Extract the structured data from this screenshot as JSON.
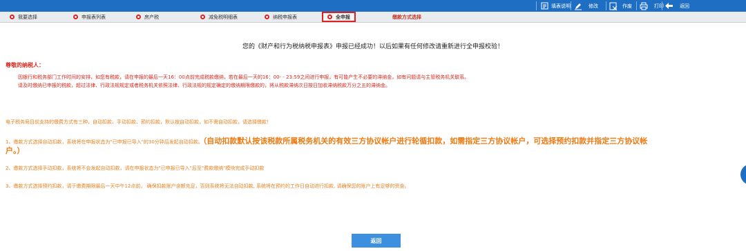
{
  "toolbar": {
    "items": [
      {
        "label": "填表说明",
        "icon": "document-icon"
      },
      {
        "label": "修改",
        "icon": "pencil-icon"
      },
      {
        "label": "作废",
        "icon": "void-icon"
      },
      {
        "label": "打印",
        "icon": "printer-icon"
      },
      {
        "label": "返回",
        "icon": "back-arrow-icon"
      }
    ]
  },
  "steps": [
    {
      "label": "我要选择"
    },
    {
      "label": "申报表列表"
    },
    {
      "label": "房产税"
    },
    {
      "label": "减免税明细表"
    },
    {
      "label": "纳税申报表"
    },
    {
      "label": "全申报"
    },
    {
      "label": "缴款方式选择"
    }
  ],
  "main": {
    "success_message": "您的《财产和行为税纳税申报表》申报已经成功！以后如果有任何修改请重新进行全申报校验！",
    "dear_label": "尊敬的纳税人：",
    "notice_lines": [
      "因银行和税务部门工作时间的安排，如您有税款，请在申报的最后一天16：00点前完成税款缴纳，若在最后一天的16：00- - 23:59之间进行申报，有可能产生不必要的滞纳金，如有问题请与主管税务机关联系。",
      "请及时缴纳已申报的税款，超过法律、行政法规规定或者税务机关依照法律、行政法规的规定确定的缴纳期限缴款的，将从税款滞纳次日按日加收滞纳税款万分之五的滞纳金。"
    ],
    "intro": "电子税务局目前支持的缴费方式有三种，自动扣款、手动扣款、预约扣款，默认按自动扣款，如不需自动扣款，请选择缴款！",
    "option1": "1、缴款方式选择自动扣款，系统将在申报状态为\"已申报已导入\"的30分钟后发起自动扣款。",
    "option1_highlight": "（自动扣款默认按该税款所属税务机关的有效三方协议帐户进行轮循扣款，如需指定三方协议帐户，可选择预约扣款并指定三方协议帐",
    "option1_highlight_cont": "户。）",
    "option2": "2、缴款方式选择手动扣款，系统将不会发起自动扣款，请在申报状态为\"已申报已导入\"后至\"费款缴纳\"模块完成手动扣款",
    "option3": "3、缴款方式选择预约扣款，请于缴费期限最后一天中午12点前， 确保扣款账户余额充足，否则系统将无法自动扣款, 系统将在预约的工作日自动进行扣款, 请确保您的账户上有足够的资金。"
  },
  "back_button_label": "返回",
  "colors": {
    "topbar": "#1e6fc4",
    "warning": "#d9271c",
    "orange": "#ee7a12",
    "button": "#3d8fe0"
  }
}
